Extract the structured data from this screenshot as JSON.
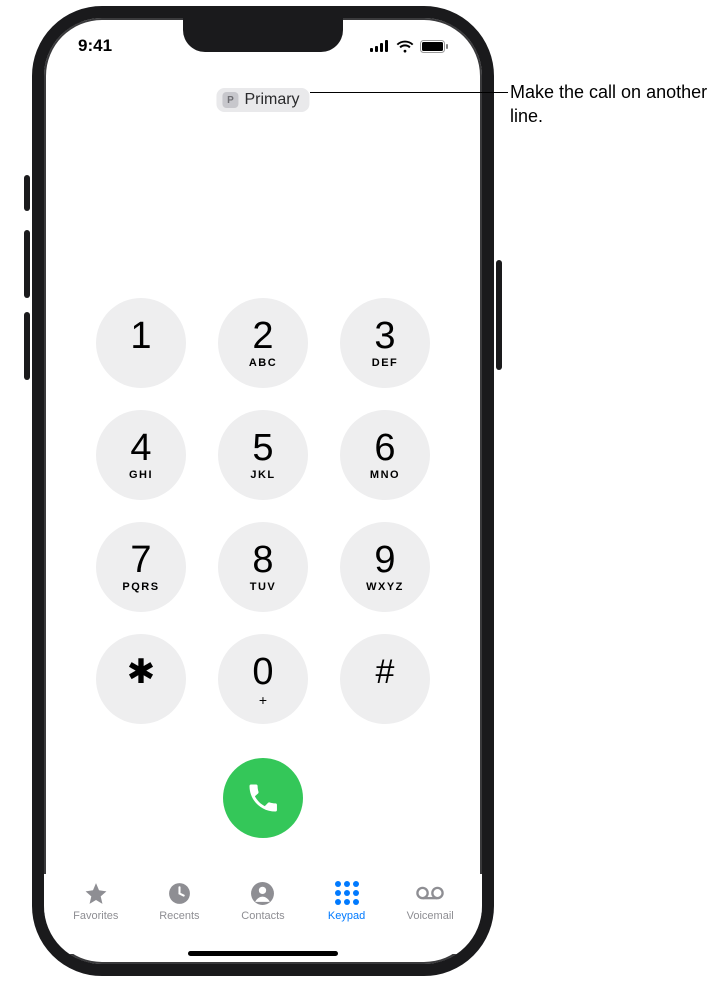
{
  "status": {
    "time": "9:41"
  },
  "sim": {
    "badge": "P",
    "label": "Primary"
  },
  "keypad": [
    {
      "digit": "1",
      "letters": ""
    },
    {
      "digit": "2",
      "letters": "ABC"
    },
    {
      "digit": "3",
      "letters": "DEF"
    },
    {
      "digit": "4",
      "letters": "GHI"
    },
    {
      "digit": "5",
      "letters": "JKL"
    },
    {
      "digit": "6",
      "letters": "MNO"
    },
    {
      "digit": "7",
      "letters": "PQRS"
    },
    {
      "digit": "8",
      "letters": "TUV"
    },
    {
      "digit": "9",
      "letters": "WXYZ"
    },
    {
      "digit": "✱",
      "letters": ""
    },
    {
      "digit": "0",
      "letters": "+"
    },
    {
      "digit": "#",
      "letters": ""
    }
  ],
  "tabs": {
    "favorites": "Favorites",
    "recents": "Recents",
    "contacts": "Contacts",
    "keypad": "Keypad",
    "voicemail": "Voicemail"
  },
  "callout": {
    "text": "Make the call on another line."
  }
}
